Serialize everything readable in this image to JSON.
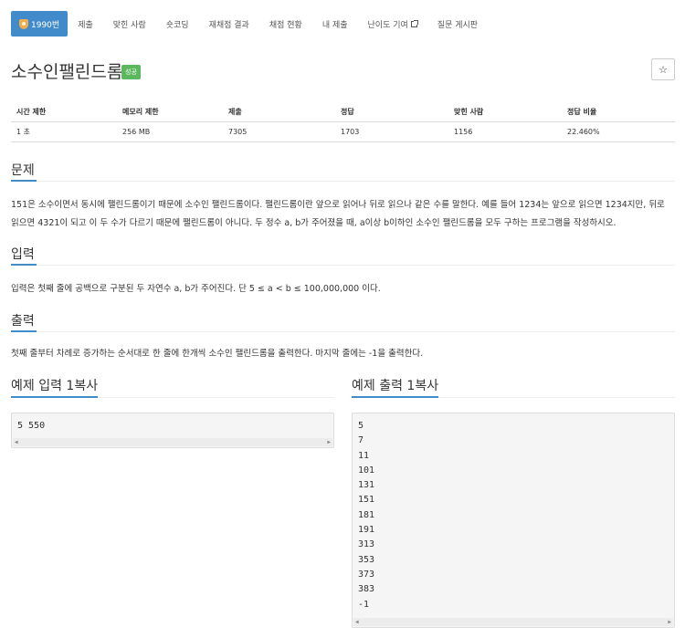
{
  "nav": {
    "items": [
      {
        "label": "1990번",
        "active": true,
        "icon": "medal-icon"
      },
      {
        "label": "제출"
      },
      {
        "label": "맞힌 사람"
      },
      {
        "label": "숏코딩"
      },
      {
        "label": "재채점 결과"
      },
      {
        "label": "채점 현황"
      },
      {
        "label": "내 제출"
      },
      {
        "label": "난이도 기여",
        "icon": "external-link-icon"
      },
      {
        "label": "질문 게시판"
      }
    ]
  },
  "problem": {
    "title": "소수인팰린드롬",
    "status": "성공",
    "star": "☆"
  },
  "info": {
    "headers": [
      "시간 제한",
      "메모리 제한",
      "제출",
      "정답",
      "맞힌 사람",
      "정답 비율"
    ],
    "values": [
      "1 초",
      "256 MB",
      "7305",
      "1703",
      "1156",
      "22.460%"
    ]
  },
  "sections": {
    "problem_heading": "문제",
    "problem_text": "151은 소수이면서 동시에 팰린드롬이기 때문에 소수인 팰린드롬이다. 팰린드롬이란 앞으로 읽어나 뒤로 읽으나 같은 수를 말한다. 예를 들어 1234는 앞으로 읽으면 1234지만, 뒤로 읽으면 4321이 되고 이 두 수가 다르기 때문에 팰린드롬이 아니다. 두 정수 a, b가 주어졌을 때, a이상 b이하인 소수인 팰린드롬을 모두 구하는 프로그램을 작성하시오.",
    "input_heading": "입력",
    "input_text": "입력은 첫째 줄에 공백으로 구분된 두 자연수 a, b가 주어진다. 단 5 ≤ a < b ≤ 100,000,000 이다.",
    "output_heading": "출력",
    "output_text": "첫째 줄부터 차례로 증가하는 순서대로 한 줄에 한개씩 소수인 팰린드롬을 출력한다. 마지막 줄에는 -1을 출력한다."
  },
  "samples": {
    "input_heading": "예제 입력 1",
    "output_heading": "예제 출력 1",
    "copy_label": "복사",
    "input": "5 550",
    "output": "5\n7\n11\n101\n131\n151\n181\n191\n313\n353\n373\n383\n-1"
  },
  "colors": {
    "accent": "#428bca",
    "success": "#5cb85c"
  }
}
